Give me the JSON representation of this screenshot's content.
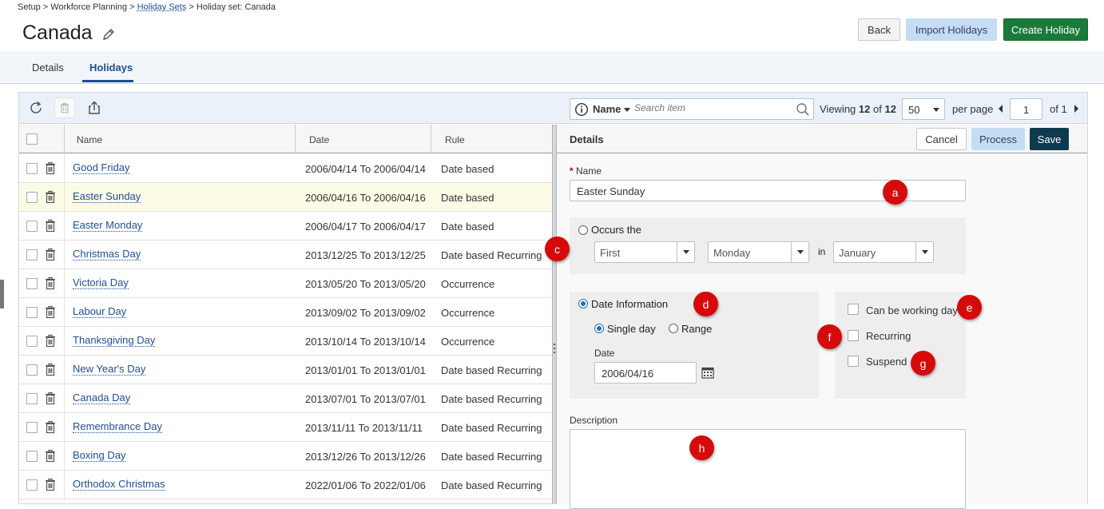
{
  "breadcrumb": {
    "part1": "Setup > Workforce Planning > ",
    "link": "Holiday Sets",
    "part2": " > Holiday set: Canada"
  },
  "page": {
    "title": "Canada"
  },
  "header_buttons": {
    "back": "Back",
    "import": "Import Holidays",
    "create": "Create Holiday"
  },
  "tabs": [
    {
      "label": "Details"
    },
    {
      "label": "Holidays"
    }
  ],
  "search": {
    "field": "Name",
    "placeholder": "Search item"
  },
  "pager": {
    "viewing_label": "Viewing",
    "shown": "12",
    "of_label": "of",
    "total": "12",
    "page_size": "50",
    "per_page_label": "per page",
    "page": "1",
    "of_pages": "of 1"
  },
  "grid": {
    "columns": {
      "name": "Name",
      "date": "Date",
      "rule": "Rule"
    },
    "rows": [
      {
        "name": "Good Friday",
        "date": "2006/04/14 To 2006/04/14",
        "rule": "Date based"
      },
      {
        "name": "Easter Sunday",
        "date": "2006/04/16 To 2006/04/16",
        "rule": "Date based"
      },
      {
        "name": "Easter Monday",
        "date": "2006/04/17 To 2006/04/17",
        "rule": "Date based"
      },
      {
        "name": "Christmas Day",
        "date": "2013/12/25 To 2013/12/25",
        "rule": "Date based Recurring"
      },
      {
        "name": "Victoria Day",
        "date": "2013/05/20 To 2013/05/20",
        "rule": "Occurrence"
      },
      {
        "name": "Labour Day",
        "date": "2013/09/02 To 2013/09/02",
        "rule": "Occurrence"
      },
      {
        "name": "Thanksgiving Day",
        "date": "2013/10/14 To 2013/10/14",
        "rule": "Occurrence"
      },
      {
        "name": "New Year's Day",
        "date": "2013/01/01 To 2013/01/01",
        "rule": "Date based Recurring"
      },
      {
        "name": "Canada Day",
        "date": "2013/07/01 To 2013/07/01",
        "rule": "Date based Recurring"
      },
      {
        "name": "Remembrance Day",
        "date": "2013/11/11 To 2013/11/11",
        "rule": "Date based Recurring"
      },
      {
        "name": "Boxing Day",
        "date": "2013/12/26 To 2013/12/26",
        "rule": "Date based Recurring"
      },
      {
        "name": "Orthodox Christmas",
        "date": "2022/01/06 To 2022/01/06",
        "rule": "Date based Recurring"
      }
    ]
  },
  "details": {
    "title": "Details",
    "buttons": {
      "cancel": "Cancel",
      "process": "Process",
      "save": "Save"
    },
    "name_label": "Name",
    "required_mark": "*",
    "name_value": "Easter Sunday",
    "occurs_label": "Occurs the",
    "occurs": {
      "ordinal": "First",
      "weekday": "Monday",
      "in_label": "in",
      "month": "January"
    },
    "date_info_label": "Date Information",
    "single_day_label": "Single day",
    "range_label": "Range",
    "date_label": "Date",
    "date_value": "2006/04/16",
    "can_be_working_day": "Can be working day",
    "recurring": "Recurring",
    "suspend": "Suspend",
    "description_label": "Description",
    "description_value": ""
  },
  "markers": [
    "a",
    "c",
    "d",
    "e",
    "f",
    "g",
    "h"
  ],
  "colors": {
    "link": "#1f4e96",
    "create_button": "#1a7a3a",
    "save_button": "#0e3a4f",
    "marker": "#d60a0a",
    "selected_row": "#fcfce6"
  }
}
